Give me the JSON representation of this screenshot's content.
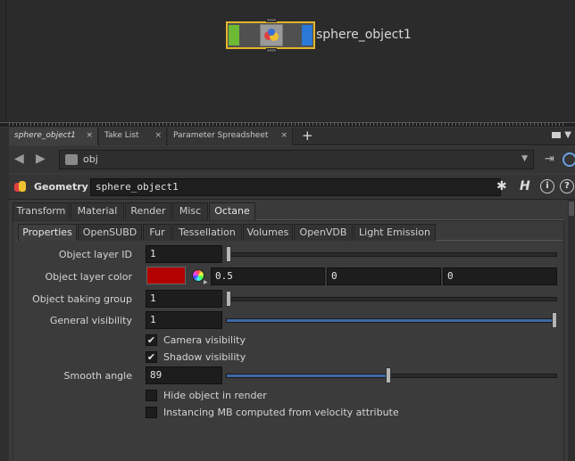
{
  "network": {
    "node_label": "sphere_object1"
  },
  "pane_tabs": [
    {
      "label": "sphere_object1",
      "close": "×"
    },
    {
      "label": "Take List",
      "close": "×"
    },
    {
      "label": "Parameter Spreadsheet",
      "close": "×"
    }
  ],
  "pane_tab_add": "+",
  "path": {
    "value": "obj"
  },
  "header": {
    "type_label": "Geometry",
    "node_name": "sphere_object1",
    "help_btn": "?",
    "info_btn": "i",
    "h_btn": "H"
  },
  "top_tabs": [
    "Transform",
    "Material",
    "Render",
    "Misc",
    "Octane"
  ],
  "sub_tabs": [
    "Properties",
    "OpenSUBD",
    "Fur",
    "Tessellation",
    "Volumes",
    "OpenVDB",
    "Light Emission"
  ],
  "params": {
    "layer_id": {
      "label": "Object layer ID",
      "value": "1",
      "slider_fraction": 0.0
    },
    "layer_color": {
      "label": "Object layer color",
      "r": "0.5",
      "g": "0",
      "b": "0",
      "swatch": "#b30000"
    },
    "baking_group": {
      "label": "Object baking group",
      "value": "1",
      "slider_fraction": 0.0
    },
    "general_visibility": {
      "label": "General visibility",
      "value": "1",
      "slider_fraction": 1.0
    },
    "camera_visibility": {
      "label": "Camera visibility",
      "checked": true
    },
    "shadow_visibility": {
      "label": "Shadow visibility",
      "checked": true
    },
    "smooth_angle": {
      "label": "Smooth angle",
      "value": "89",
      "slider_fraction": 0.49
    },
    "hide_object": {
      "label": "Hide object in render",
      "checked": false
    },
    "instancing_mb": {
      "label": "Instancing MB computed from velocity attribute",
      "checked": false
    }
  },
  "colors": {
    "node_selected": "#e3b52b",
    "node_display_flag": "#2b78d6",
    "node_bypass": "#6cb934",
    "slider_fill": "#3f68a8"
  }
}
